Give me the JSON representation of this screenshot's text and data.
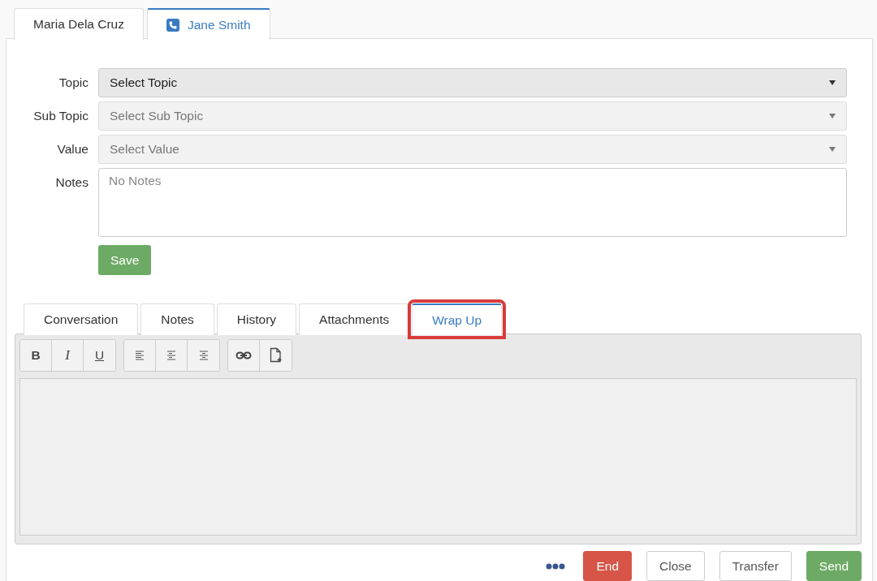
{
  "contact_tabs": [
    {
      "label": "Maria Dela Cruz",
      "selected": false,
      "on_call": false
    },
    {
      "label": "Jane Smith",
      "selected": true,
      "on_call": true
    }
  ],
  "form": {
    "fields": [
      {
        "label": "Topic",
        "kind": "select",
        "placeholder": "Select Topic",
        "disabled": false
      },
      {
        "label": "Sub Topic",
        "kind": "select",
        "placeholder": "Select Sub Topic",
        "disabled": true
      },
      {
        "label": "Value",
        "kind": "select",
        "placeholder": "Select Value",
        "disabled": true
      },
      {
        "label": "Notes",
        "kind": "textarea",
        "placeholder": "No Notes"
      }
    ],
    "save_button": "Save"
  },
  "section_tabs": [
    {
      "label": "Conversation",
      "selected": false,
      "highlighted": false
    },
    {
      "label": "Notes",
      "selected": false,
      "highlighted": false
    },
    {
      "label": "History",
      "selected": false,
      "highlighted": false
    },
    {
      "label": "Attachments",
      "selected": false,
      "highlighted": false
    },
    {
      "label": "Wrap Up",
      "selected": true,
      "highlighted": true
    }
  ],
  "toolbar": [
    [
      {
        "kind": "bold",
        "label": "B"
      },
      {
        "kind": "italic",
        "label": "I"
      },
      {
        "kind": "underline",
        "label": "U"
      }
    ],
    [
      {
        "kind": "align-left"
      },
      {
        "kind": "align-center"
      },
      {
        "kind": "align-right"
      }
    ],
    [
      {
        "kind": "link"
      },
      {
        "kind": "file"
      }
    ]
  ],
  "actions": [
    {
      "kind": "more"
    },
    {
      "kind": "danger",
      "label": "End"
    },
    {
      "kind": "default",
      "label": "Close"
    },
    {
      "kind": "default",
      "label": "Transfer"
    },
    {
      "kind": "primary",
      "label": "Send"
    }
  ]
}
